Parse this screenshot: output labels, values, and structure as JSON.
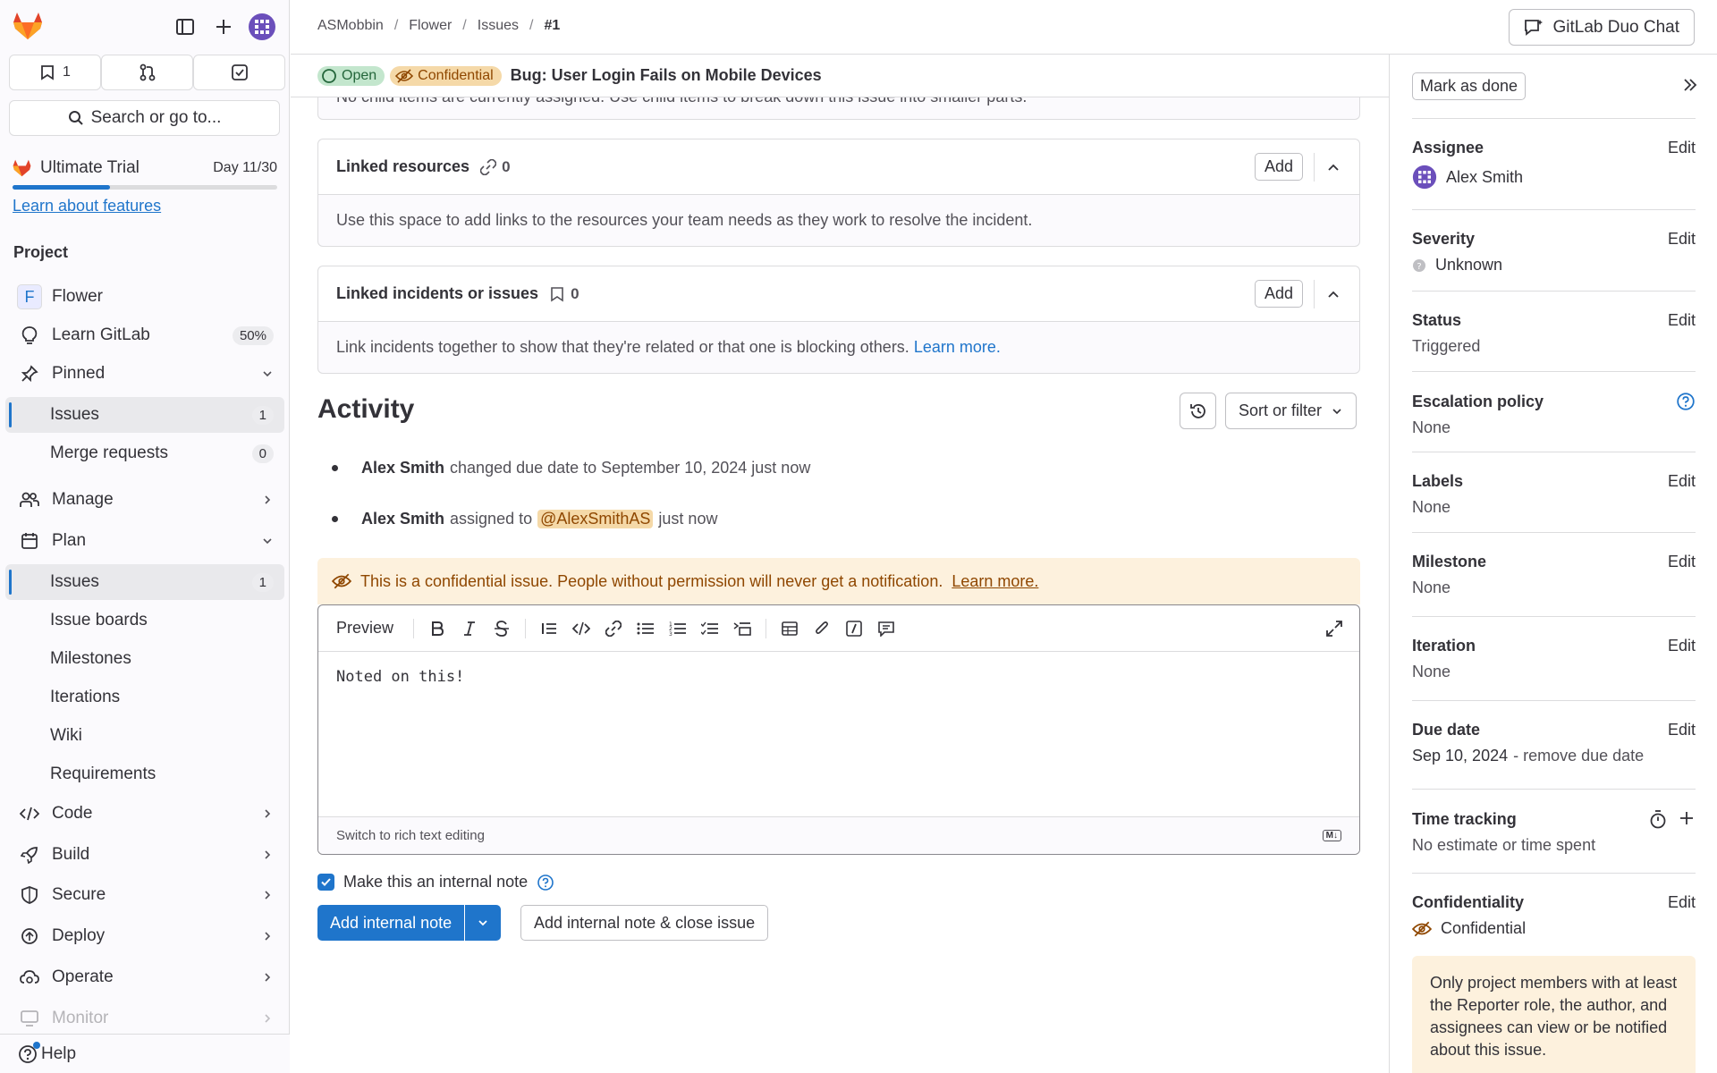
{
  "sidebar": {
    "top_buttons": [
      {
        "icon": "issues-icon",
        "label": "1"
      },
      {
        "icon": "merge-request-icon",
        "label": ""
      },
      {
        "icon": "todo-icon",
        "label": ""
      }
    ],
    "search_label": "Search or go to...",
    "trial": {
      "name": "Ultimate Trial",
      "day": "Day 11/30",
      "progress": 0.367,
      "learn_link": "Learn about features"
    },
    "section_title": "Project",
    "items": [
      {
        "label": "Flower",
        "icon": "project-avatar",
        "avatar_letter": "F"
      },
      {
        "label": "Learn GitLab",
        "icon": "bulb-icon",
        "badge": "50%"
      },
      {
        "label": "Pinned",
        "icon": "pin-icon"
      },
      {
        "label": "Issues",
        "badge": "1"
      },
      {
        "label": "Merge requests",
        "badge": "0"
      },
      {
        "label": "Manage",
        "icon": "users-icon"
      },
      {
        "label": "Plan",
        "icon": "planning-icon"
      },
      {
        "label": "Issues",
        "badge": "1"
      },
      {
        "label": "Issue boards"
      },
      {
        "label": "Milestones"
      },
      {
        "label": "Iterations"
      },
      {
        "label": "Wiki"
      },
      {
        "label": "Requirements"
      },
      {
        "label": "Code",
        "icon": "code-icon"
      },
      {
        "label": "Build",
        "icon": "rocket-icon"
      },
      {
        "label": "Secure",
        "icon": "shield-icon"
      },
      {
        "label": "Deploy",
        "icon": "deploy-icon"
      },
      {
        "label": "Operate",
        "icon": "cloud-gear-icon"
      },
      {
        "label": "Monitor",
        "icon": "monitor-icon"
      }
    ],
    "help_label": "Help"
  },
  "header": {
    "breadcrumbs": [
      "ASMobbin",
      "Flower",
      "Issues",
      "#1"
    ],
    "duo_label": "GitLab Duo Chat"
  },
  "issue": {
    "state": "Open",
    "confidential_label": "Confidential",
    "title": "Bug: User Login Fails on Mobile Devices",
    "child_items_text": "No child items are currently assigned. Use child items to break down this issue into smaller parts."
  },
  "linked_resources": {
    "title": "Linked resources",
    "count": "0",
    "add_label": "Add",
    "body": "Use this space to add links to the resources your team needs as they work to resolve the incident."
  },
  "linked_incidents": {
    "title": "Linked incidents or issues",
    "count": "0",
    "add_label": "Add",
    "body": "Link incidents together to show that they're related or that one is blocking others.",
    "learn_more": "Learn more."
  },
  "activity": {
    "title": "Activity",
    "sort_label": "Sort or filter",
    "items": [
      {
        "author": "Alex Smith",
        "text": "changed due date to September 10, 2024 just now"
      },
      {
        "author": "Alex Smith",
        "text_before": "assigned to",
        "mention": "@AlexSmithAS",
        "text_after": "just now"
      }
    ]
  },
  "comment": {
    "confidential_warning": "This is a confidential issue. People without permission will never get a notification.",
    "warning_link": "Learn more.",
    "preview_label": "Preview",
    "text": "Noted on this!",
    "rich_text_label": "Switch to rich text editing",
    "md_badge": "M↓",
    "internal_note_label": "Make this an internal note",
    "internal_checked": true,
    "submit_label": "Add internal note",
    "close_label": "Add internal note & close issue"
  },
  "right_sidebar": {
    "mark_done": "Mark as done",
    "edit_label": "Edit",
    "assignee": {
      "title": "Assignee",
      "value": "Alex Smith"
    },
    "severity": {
      "title": "Severity",
      "value": "Unknown"
    },
    "status": {
      "title": "Status",
      "value": "Triggered"
    },
    "escalation": {
      "title": "Escalation policy",
      "value": "None"
    },
    "labels": {
      "title": "Labels",
      "value": "None"
    },
    "milestone": {
      "title": "Milestone",
      "value": "None"
    },
    "iteration": {
      "title": "Iteration",
      "value": "None"
    },
    "due_date": {
      "title": "Due date",
      "value": "Sep 10, 2024",
      "remove": "- remove due date"
    },
    "time_tracking": {
      "title": "Time tracking",
      "value": "No estimate or time spent"
    },
    "confidentiality": {
      "title": "Confidentiality",
      "value": "Confidential"
    },
    "confidential_note": "Only project members with at least the Reporter role, the author, and assignees can view or be notified about this issue."
  },
  "colors": {
    "accent": "#1f75cb",
    "brand_orange": "#e24329",
    "open_green": "#24663b",
    "confidential": "#8f4700"
  }
}
